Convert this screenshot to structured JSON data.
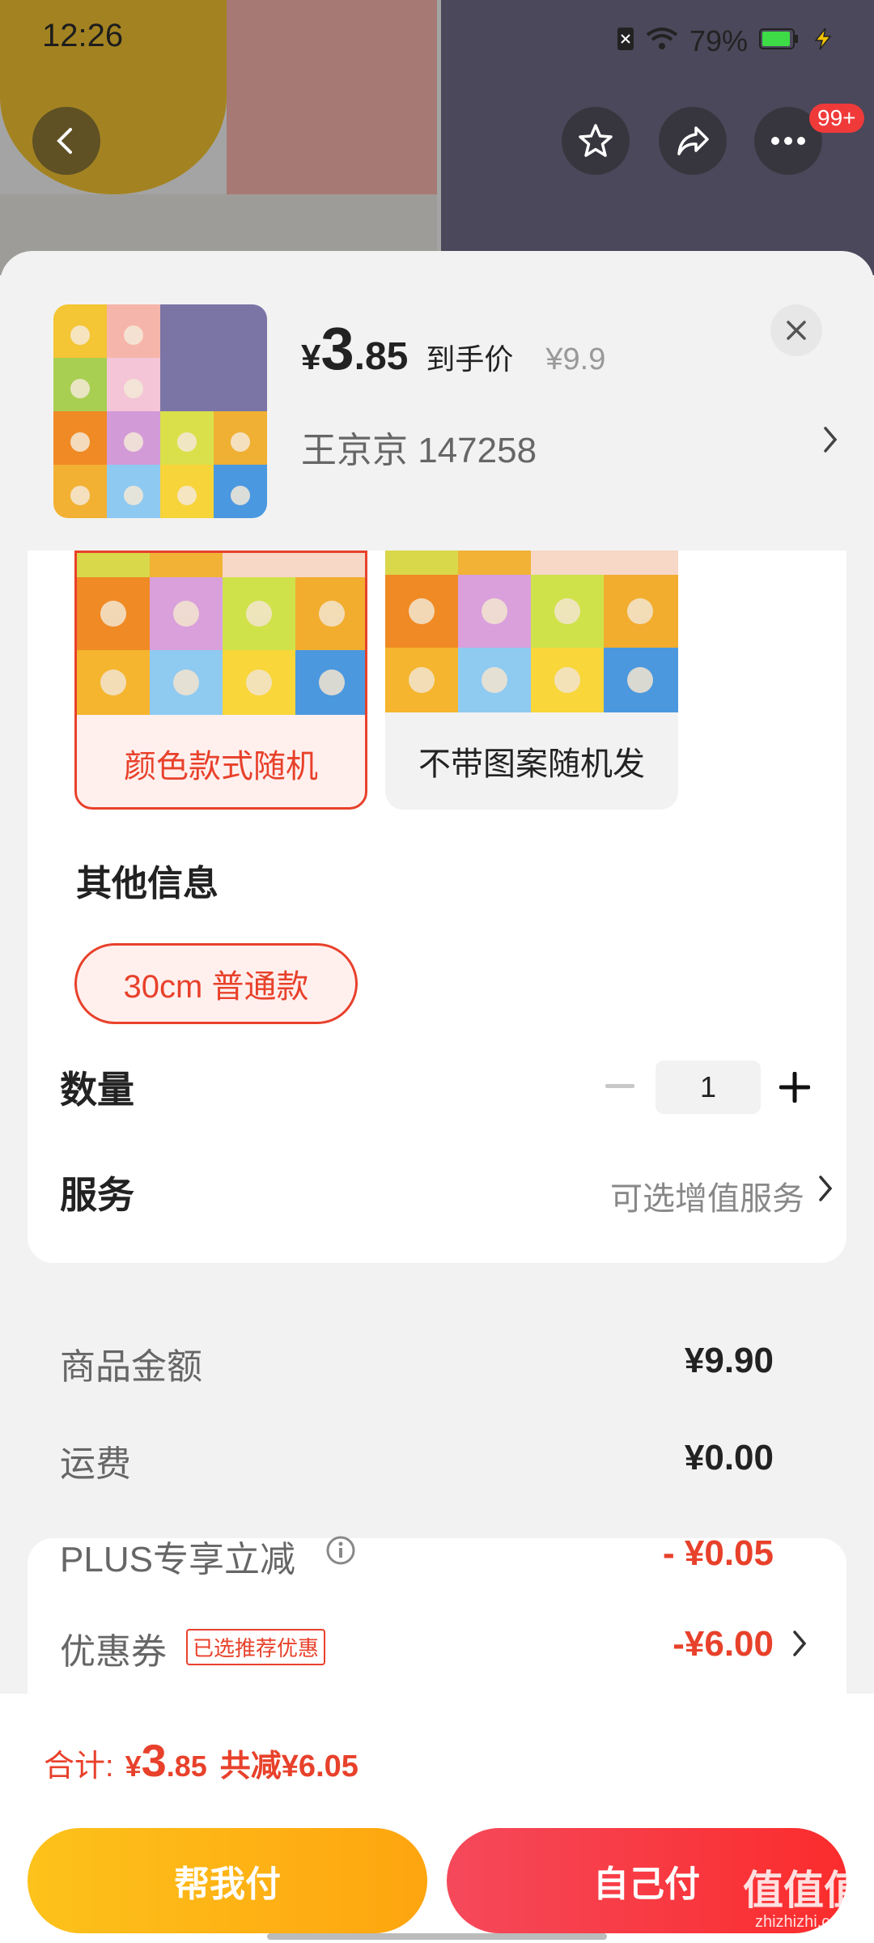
{
  "status_bar": {
    "time": "12:26",
    "battery": "79%"
  },
  "header": {
    "more_badge": "99+"
  },
  "product": {
    "price_yen": "¥",
    "price_int": "3",
    "price_dec": ".85",
    "price_note": "到手价",
    "original_price": "¥9.9",
    "seller": "王京京  147258"
  },
  "options": [
    {
      "label": "颜色款式随机",
      "selected": true
    },
    {
      "label": "不带图案随机发",
      "selected": false
    }
  ],
  "other_info": {
    "title": "其他信息",
    "option": "30cm 普通款"
  },
  "quantity": {
    "label": "数量",
    "value": "1"
  },
  "service": {
    "label": "服务",
    "hint": "可选增值服务"
  },
  "fees": {
    "goods_label": "商品金额",
    "goods_value": "¥9.90",
    "shipping_label": "运费",
    "shipping_value": "¥0.00",
    "plus_label": "PLUS专享立减",
    "plus_value": "- ¥0.05",
    "coupon_label": "优惠券",
    "coupon_tag": "已选推荐优惠",
    "coupon_value": "-¥6.00"
  },
  "total": {
    "label": "合计:",
    "yen": "¥",
    "int": "3",
    "dec": ".85",
    "saved": "共减¥6.05"
  },
  "buttons": {
    "help_pay": "帮我付",
    "self_pay": "自己付"
  },
  "watermark": {
    "text": "值值值",
    "sub": "zhizhizhi.com"
  },
  "colors": {
    "accent_red": "#e8412b",
    "help_btn": "#fdb515",
    "self_btn": "#f73a45"
  }
}
